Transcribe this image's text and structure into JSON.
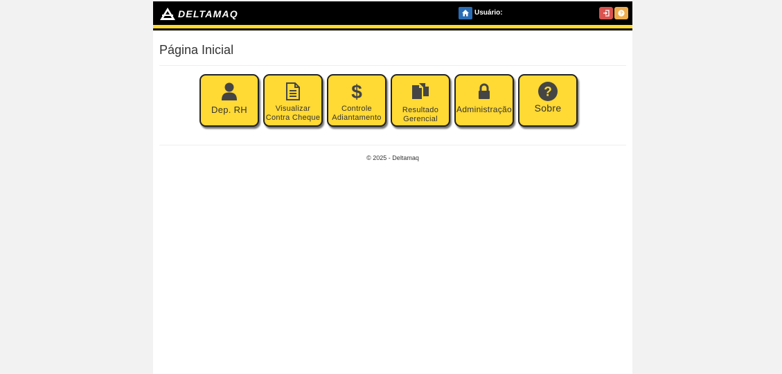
{
  "brand": {
    "name": "DELTAMAQ"
  },
  "navbar": {
    "home_icon": "home-icon",
    "user_label": "Usuário:",
    "logout_icon": "logout-icon",
    "help_icon": "question-icon"
  },
  "page": {
    "title": "Página Inicial"
  },
  "tiles": [
    {
      "line1": "Dep. RH",
      "line2": "",
      "icon": "user-icon"
    },
    {
      "line1": "Visualizar",
      "line2": "Contra Cheque",
      "icon": "document-icon"
    },
    {
      "line1": "Controle",
      "line2": "Adiantamento",
      "icon": "dollar-icon"
    },
    {
      "line1": "Resultado",
      "line2": "Gerencial",
      "icon": "files-icon"
    },
    {
      "line1": "Administração",
      "line2": "",
      "icon": "lock-icon"
    },
    {
      "line1": "Sobre",
      "line2": "",
      "icon": "question-circle-icon"
    }
  ],
  "footer": {
    "text": "© 2025 - Deltamaq"
  },
  "colors": {
    "tile": "#ffd934",
    "navbar": "#000000",
    "accent": "#ffd92f",
    "home": "#2a6db5",
    "logout": "#d9534f",
    "help": "#f0ad4e"
  }
}
